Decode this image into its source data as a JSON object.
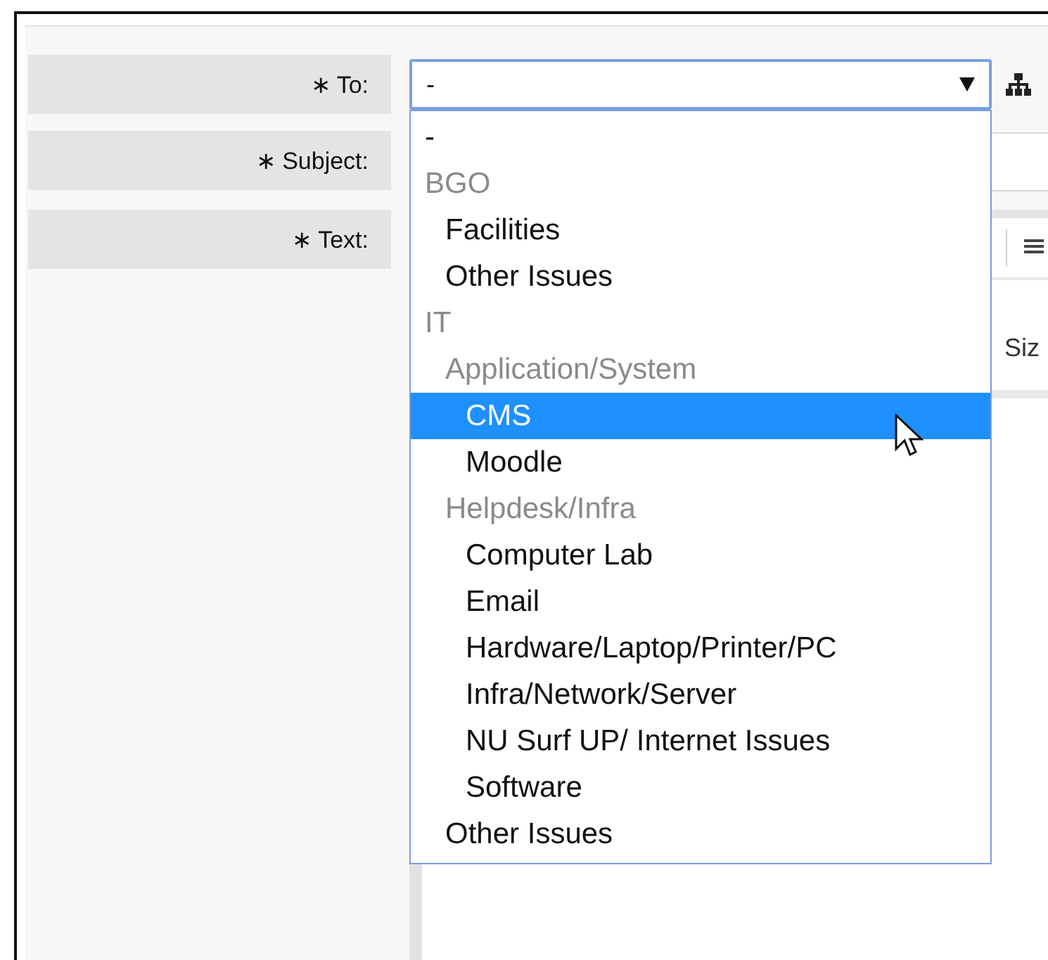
{
  "form": {
    "fields": [
      {
        "label": "∗ To:",
        "kind": "select",
        "value": "-"
      },
      {
        "label": "∗ Subject:",
        "kind": "text"
      },
      {
        "label": "∗ Text:",
        "kind": "editor"
      }
    ]
  },
  "dropdown": {
    "options": [
      {
        "label": "-",
        "kind": "option",
        "selected": false
      },
      {
        "label": "BGO",
        "kind": "group",
        "children": [
          {
            "label": "Facilities",
            "kind": "option",
            "selected": false
          },
          {
            "label": "Other Issues",
            "kind": "option",
            "selected": false
          }
        ]
      },
      {
        "label": "IT",
        "kind": "group",
        "children": [
          {
            "label": "Application/System",
            "kind": "group",
            "children": [
              {
                "label": "CMS",
                "kind": "option",
                "selected": true
              },
              {
                "label": "Moodle",
                "kind": "option",
                "selected": false
              }
            ]
          },
          {
            "label": "Helpdesk/Infra",
            "kind": "group",
            "children": [
              {
                "label": "Computer Lab",
                "kind": "option",
                "selected": false
              },
              {
                "label": "Email",
                "kind": "option",
                "selected": false
              },
              {
                "label": "Hardware/Laptop/Printer/PC",
                "kind": "option",
                "selected": false
              },
              {
                "label": "Infra/Network/Server",
                "kind": "option",
                "selected": false
              },
              {
                "label": "NU Surf UP/ Internet Issues",
                "kind": "option",
                "selected": false
              },
              {
                "label": "Software",
                "kind": "option",
                "selected": false
              }
            ]
          },
          {
            "label": "Other Issues",
            "kind": "option",
            "selected": false
          }
        ]
      }
    ]
  },
  "editor": {
    "toolbar_label": "Siz"
  }
}
